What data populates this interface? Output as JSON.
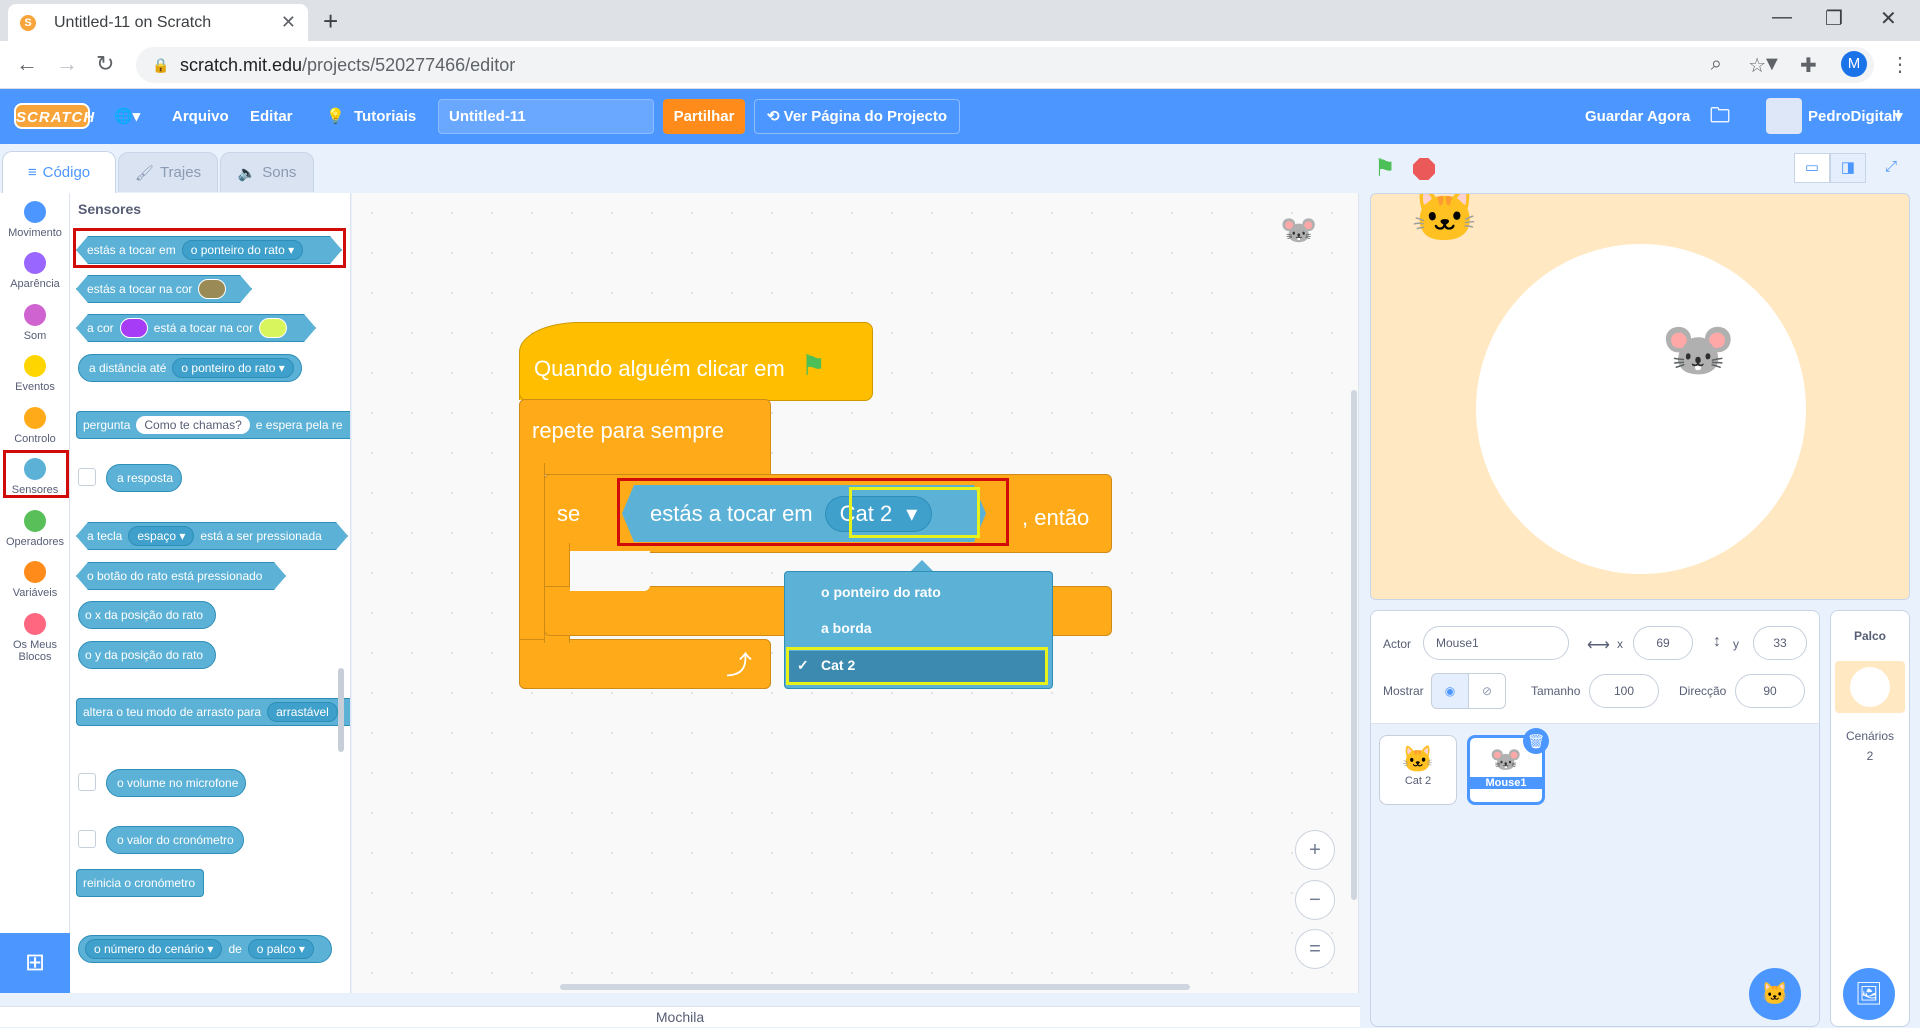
{
  "browser": {
    "tab_title": "Untitled-11 on Scratch",
    "url_host": "scratch.mit.edu",
    "url_path": "/projects/520277466/editor",
    "profile_initial": "M"
  },
  "menu": {
    "logo": "SCRATCH",
    "file": "Arquivo",
    "edit": "Editar",
    "tutorials": "Tutoriais",
    "project_title": "Untitled-11",
    "share": "Partilhar",
    "project_page": "Ver Página do Projecto",
    "save_now": "Guardar Agora",
    "username": "PedroDigitall"
  },
  "editor_tabs": {
    "code": "Código",
    "costumes": "Trajes",
    "sounds": "Sons"
  },
  "categories": [
    {
      "label": "Movimento",
      "color": "#4c97ff"
    },
    {
      "label": "Aparência",
      "color": "#9966ff"
    },
    {
      "label": "Som",
      "color": "#cf63cf"
    },
    {
      "label": "Eventos",
      "color": "#ffd500"
    },
    {
      "label": "Controlo",
      "color": "#ffab19"
    },
    {
      "label": "Sensores",
      "color": "#5cb1d6"
    },
    {
      "label": "Operadores",
      "color": "#59c059"
    },
    {
      "label": "Variáveis",
      "color": "#ff8c1a"
    },
    {
      "label": "Os Meus Blocos",
      "color": "#ff6680"
    }
  ],
  "palette": {
    "heading": "Sensores",
    "touching": "estás a tocar em",
    "touching_value": "o ponteiro do rato",
    "touching_color": "estás a tocar na cor",
    "color_a": "a cor",
    "color_touching": "está a tocar na cor",
    "distance": "a distância até",
    "distance_value": "o ponteiro do rato",
    "ask": "pergunta",
    "ask_value": "Como te chamas?",
    "ask_wait": "e espera pela re",
    "answer": "a resposta",
    "key": "a tecla",
    "key_value": "espaço",
    "key_pressed": "está a ser pressionada",
    "mouse_down": "o botão do rato está pressionado",
    "mouse_x": "o x da posição do rato",
    "mouse_y": "o y da posição do rato",
    "drag_mode": "altera o teu modo de arrasto para",
    "drag_value": "arrastável",
    "loudness": "o volume no microfone",
    "timer": "o valor do cronómetro",
    "reset_timer": "reinicia o cronómetro",
    "backdrop_num": "o número do cenário",
    "of": "de",
    "stage_value": "o palco"
  },
  "script": {
    "hat": "Quando alguém clicar em",
    "forever": "repete para sempre",
    "if": "se",
    "touching": "estás a tocar em",
    "target": "Cat 2",
    "then": ", então"
  },
  "dropdown": {
    "options": [
      "o ponteiro do rato",
      "a borda",
      "Cat 2"
    ],
    "selected_mark": "✓"
  },
  "zoom": {
    "in": "+",
    "out": "−",
    "reset": "="
  },
  "sprite_info": {
    "actor_label": "Actor",
    "actor_name": "Mouse1",
    "x_label": "x",
    "x": "69",
    "y_label": "y",
    "y": "33",
    "show_label": "Mostrar",
    "size_label": "Tamanho",
    "size": "100",
    "direction_label": "Direcção",
    "direction": "90"
  },
  "sprites": [
    {
      "name": "Cat 2"
    },
    {
      "name": "Mouse1"
    }
  ],
  "stage_panel": {
    "title": "Palco",
    "backdrops_label": "Cenários",
    "backdrops_count": "2"
  },
  "backpack": "Mochila"
}
